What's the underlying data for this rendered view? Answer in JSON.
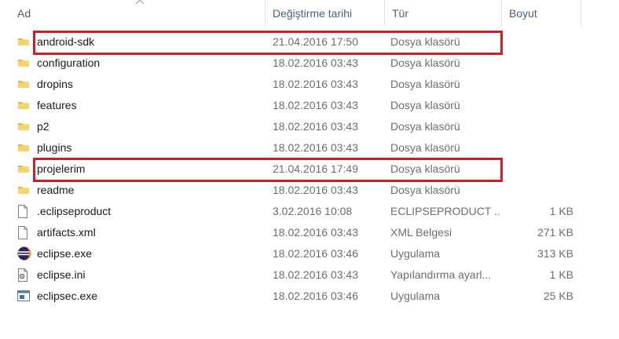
{
  "columns": {
    "name": "Ad",
    "date": "Değiştirme tarihi",
    "type": "Tür",
    "size": "Boyut"
  },
  "files": [
    {
      "name": "android-sdk",
      "date": "21.04.2016 17:50",
      "type": "Dosya klasörü",
      "size": "",
      "icon": "folder-icon",
      "highlighted": true
    },
    {
      "name": "configuration",
      "date": "18.02.2016 03:43",
      "type": "Dosya klasörü",
      "size": "",
      "icon": "folder-icon",
      "highlighted": false
    },
    {
      "name": "dropins",
      "date": "18.02.2016 03:43",
      "type": "Dosya klasörü",
      "size": "",
      "icon": "folder-icon",
      "highlighted": false
    },
    {
      "name": "features",
      "date": "18.02.2016 03:43",
      "type": "Dosya klasörü",
      "size": "",
      "icon": "folder-icon",
      "highlighted": false
    },
    {
      "name": "p2",
      "date": "18.02.2016 03:43",
      "type": "Dosya klasörü",
      "size": "",
      "icon": "folder-icon",
      "highlighted": false
    },
    {
      "name": "plugins",
      "date": "18.02.2016 03:43",
      "type": "Dosya klasörü",
      "size": "",
      "icon": "folder-icon",
      "highlighted": false
    },
    {
      "name": "projelerim",
      "date": "21.04.2016 17:49",
      "type": "Dosya klasörü",
      "size": "",
      "icon": "folder-icon",
      "highlighted": true
    },
    {
      "name": "readme",
      "date": "18.02.2016 03:43",
      "type": "Dosya klasörü",
      "size": "",
      "icon": "folder-icon",
      "highlighted": false
    },
    {
      "name": ".eclipseproduct",
      "date": "3.02.2016 10:08",
      "type": "ECLIPSEPRODUCT ...",
      "size": "1 KB",
      "icon": "document-icon",
      "highlighted": false
    },
    {
      "name": "artifacts.xml",
      "date": "18.02.2016 03:43",
      "type": "XML Belgesi",
      "size": "271 KB",
      "icon": "document-icon",
      "highlighted": false
    },
    {
      "name": "eclipse.exe",
      "date": "18.02.2016 03:46",
      "type": "Uygulama",
      "size": "313 KB",
      "icon": "eclipse-icon",
      "highlighted": false
    },
    {
      "name": "eclipse.ini",
      "date": "18.02.2016 03:43",
      "type": "Yapılandırma ayarl...",
      "size": "1 KB",
      "icon": "settings-file-icon",
      "highlighted": false
    },
    {
      "name": "eclipsec.exe",
      "date": "18.02.2016 03:46",
      "type": "Uygulama",
      "size": "25 KB",
      "icon": "application-icon",
      "highlighted": false
    }
  ],
  "colors": {
    "highlight": "#cc1f2a",
    "folder": "#f5c64a"
  }
}
